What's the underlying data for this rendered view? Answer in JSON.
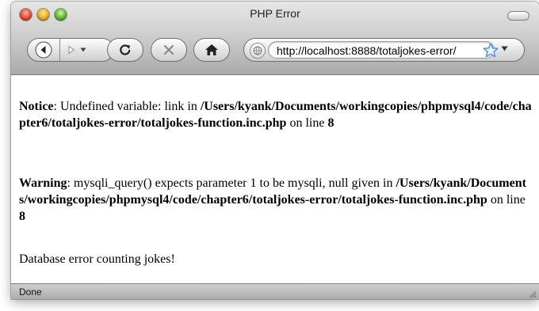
{
  "window": {
    "title": "PHP Error"
  },
  "toolbar": {
    "back_icon": "back-arrow-icon",
    "forward_icon": "forward-arrow-icon",
    "reload_icon": "reload-icon",
    "stop_icon": "stop-icon",
    "home_icon": "home-icon"
  },
  "address_bar": {
    "url": "http://localhost:8888/totaljokes-error/",
    "site_icon": "site-icon",
    "bookmark_icon": "star-icon"
  },
  "content": {
    "notice": {
      "label": "Notice",
      "text": ": Undefined variable: link in ",
      "path": "/Users/kyank/Documents/workingcopies/phpmysql4/code/chapter6/totaljokes-error/totaljokes-function.inc.php",
      "on_line": " on line ",
      "line": "8"
    },
    "warning": {
      "label": "Warning",
      "text": ": mysqli_query() expects parameter 1 to be mysqli, null given in ",
      "path": "/Users/kyank/Documents/workingcopies/phpmysql4/code/chapter6/totaljokes-error/totaljokes-function.inc.php",
      "on_line": " on line ",
      "line": "8"
    },
    "error_message": "Database error counting jokes!"
  },
  "status_bar": {
    "text": "Done"
  },
  "colors": {
    "close": "#f0553e",
    "minimize": "#f5b62a",
    "maximize": "#6ec33c",
    "star": "#4a90d9"
  }
}
